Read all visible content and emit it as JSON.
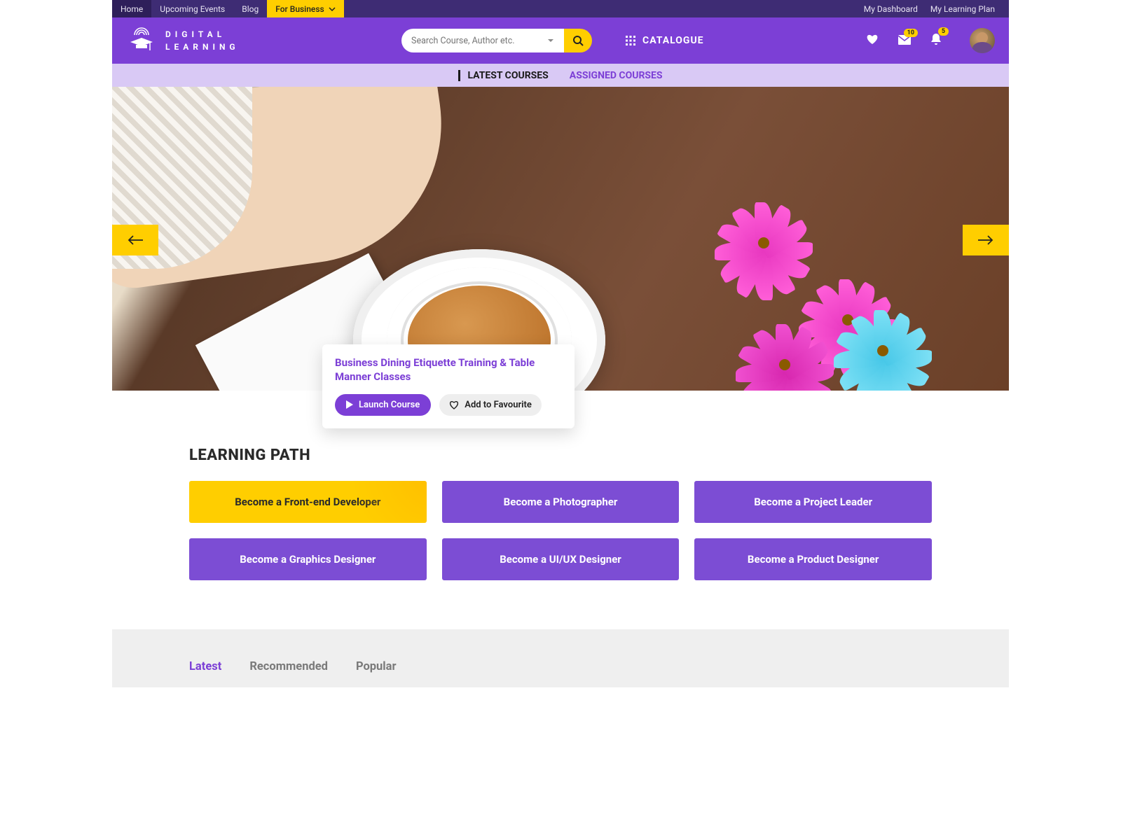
{
  "topbar": {
    "left": [
      {
        "label": "Home",
        "active": true
      },
      {
        "label": "Upcoming Events"
      },
      {
        "label": "Blog"
      },
      {
        "label": "For Business",
        "business": true
      }
    ],
    "right": [
      {
        "label": "My Dashboard"
      },
      {
        "label": "My Learning Plan"
      }
    ]
  },
  "logo": {
    "line1": "DIGITAL",
    "line2": "LEARNING"
  },
  "search": {
    "placeholder": "Search Course, Author etc."
  },
  "catalogue_label": "CATALOGUE",
  "notifications": {
    "messages_badge": "10",
    "bell_badge": "5"
  },
  "subnav": {
    "tabs": [
      {
        "label": "LATEST COURSES",
        "active": true
      },
      {
        "label": "ASSIGNED COURSES"
      }
    ]
  },
  "hero": {
    "title": "Business Dining Etiquette Training & Table Manner Classes",
    "launch_label": "Launch Course",
    "favourite_label": "Add to Favourite"
  },
  "learning_path": {
    "heading": "LEARNING PATH",
    "cards": [
      {
        "label": "Become a Front-end Developer",
        "highlight": true
      },
      {
        "label": "Become a Photographer"
      },
      {
        "label": "Become a Project Leader"
      },
      {
        "label": "Become a Graphics Designer"
      },
      {
        "label": "Become a UI/UX Designer"
      },
      {
        "label": "Become a Product Designer"
      }
    ]
  },
  "filters": {
    "tabs": [
      {
        "label": "Latest",
        "active": true
      },
      {
        "label": "Recommended"
      },
      {
        "label": "Popular"
      }
    ]
  },
  "colors": {
    "primary": "#7c3fd6",
    "accent": "#ffce00"
  }
}
